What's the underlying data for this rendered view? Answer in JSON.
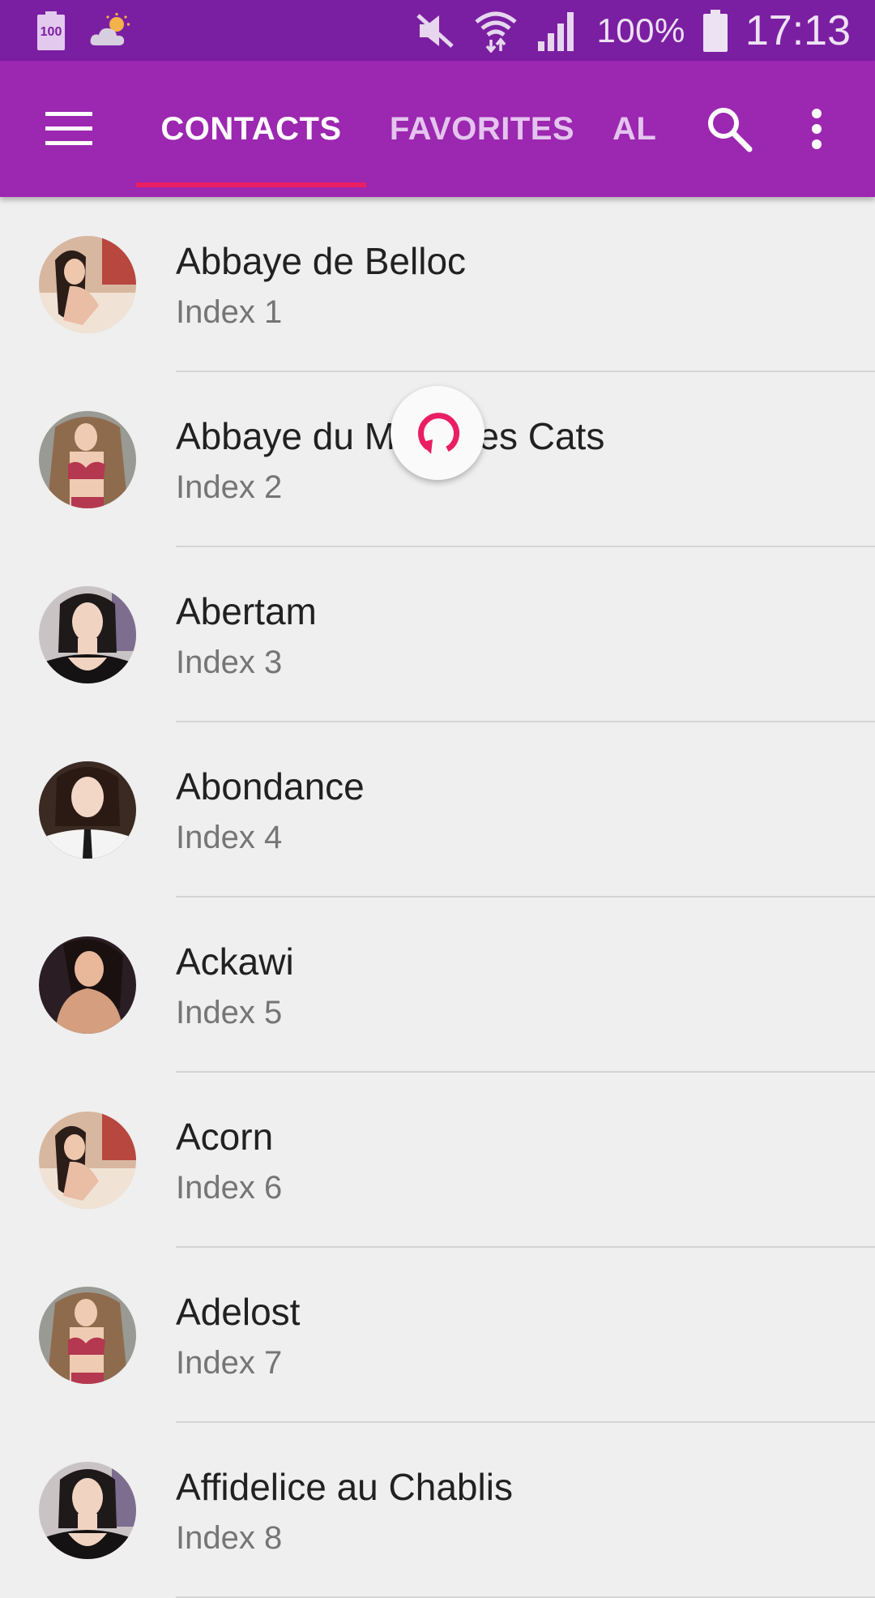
{
  "status_bar": {
    "battery_widget_label": "100",
    "battery_percent": "100%",
    "time": "17:13",
    "icons": [
      "battery-widget-icon",
      "weather-icon",
      "mute-icon",
      "wifi-icon",
      "signal-icon",
      "battery-icon"
    ]
  },
  "app_bar": {
    "tabs": [
      {
        "label": "CONTACTS",
        "selected": true
      },
      {
        "label": "FAVORITES",
        "selected": false
      },
      {
        "label": "AL",
        "selected": false
      }
    ],
    "icons": [
      "menu-icon",
      "search-icon",
      "more-vert-icon"
    ]
  },
  "colors": {
    "status_bar": "#7b1fa2",
    "app_bar": "#9c27b0",
    "accent": "#e91e63",
    "background": "#efefef"
  },
  "contacts": [
    {
      "name": "Abbaye de Belloc",
      "subtitle": "Index 1"
    },
    {
      "name": "Abbaye du Mont des Cats",
      "subtitle": "Index 2"
    },
    {
      "name": "Abertam",
      "subtitle": "Index 3"
    },
    {
      "name": "Abondance",
      "subtitle": "Index 4"
    },
    {
      "name": "Ackawi",
      "subtitle": "Index 5"
    },
    {
      "name": "Acorn",
      "subtitle": "Index 6"
    },
    {
      "name": "Adelost",
      "subtitle": "Index 7"
    },
    {
      "name": "Affidelice au Chablis",
      "subtitle": "Index 8"
    }
  ],
  "refresh_indicator": {
    "icon": "refresh-icon"
  }
}
